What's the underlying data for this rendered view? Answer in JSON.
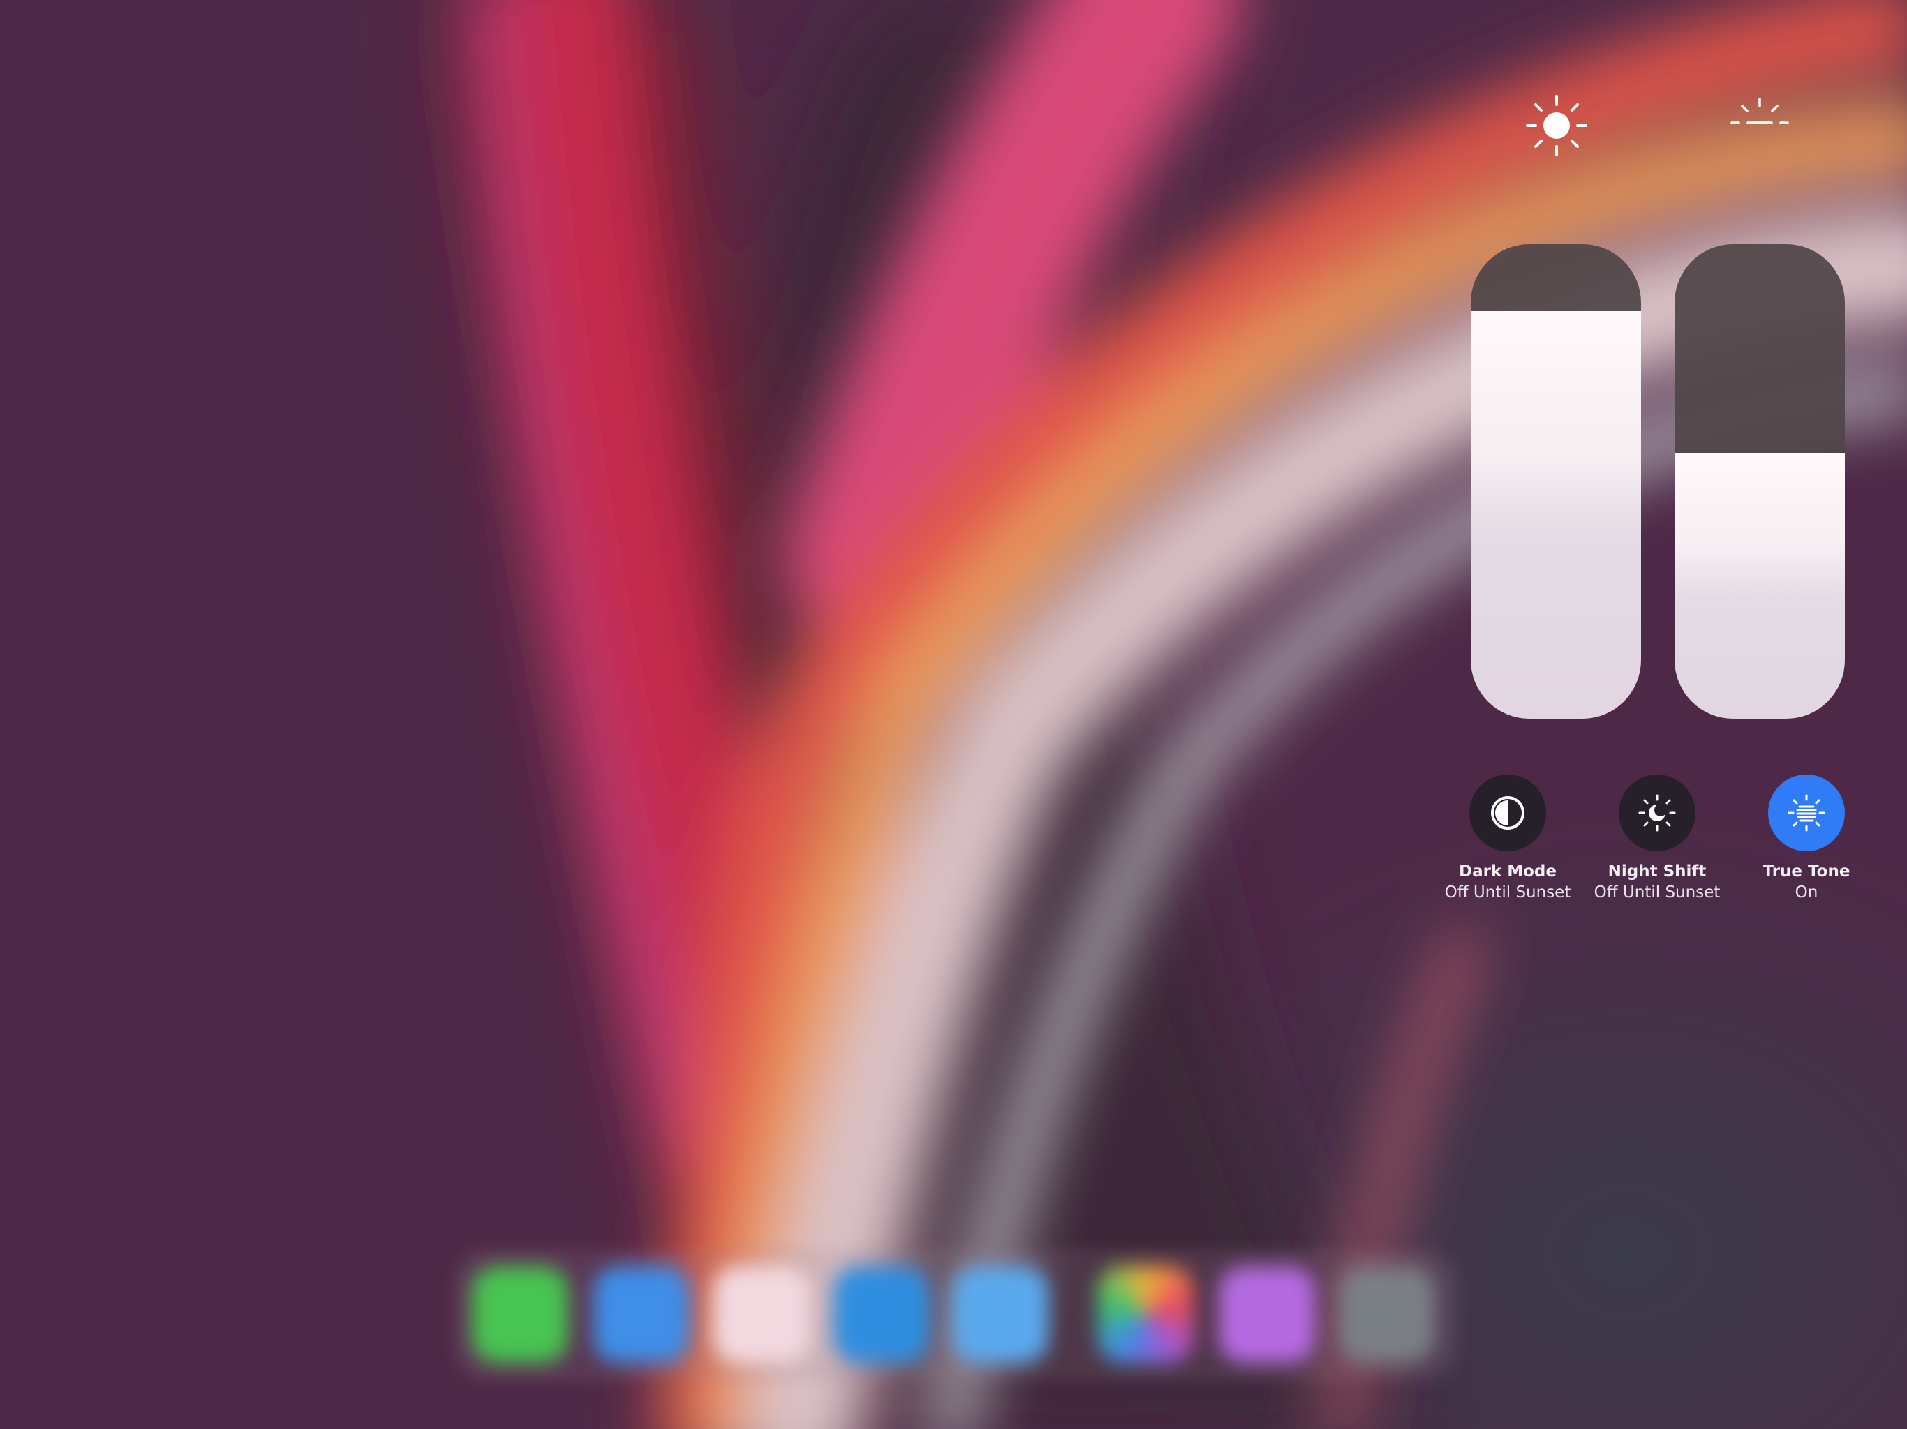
{
  "control_center": {
    "brightness": {
      "icon": "sun-icon",
      "level": 0.86
    },
    "true_tone_slider": {
      "icon": "sunrise-icon",
      "level": 0.56
    },
    "toggles": [
      {
        "icon": "dark-mode-icon",
        "title": "Dark Mode",
        "subtitle": "Off Until Sunset",
        "state": "off",
        "color": "#26202a"
      },
      {
        "icon": "night-shift-icon",
        "title": "Night Shift",
        "subtitle": "Off Until Sunset",
        "state": "off",
        "color": "#26202a"
      },
      {
        "icon": "true-tone-icon",
        "title": "True Tone",
        "subtitle": "On",
        "state": "on",
        "color": "#2f7cf6"
      }
    ]
  },
  "dock": {
    "apps": [
      {
        "icon": "messages-icon",
        "color": "#47c451"
      },
      {
        "icon": "safari-icon",
        "color": "#3f8ee8"
      },
      {
        "icon": "music-icon",
        "color": "#f2d9e0"
      },
      {
        "icon": "mail-icon",
        "color": "#2f8ee0"
      },
      {
        "icon": "files-icon",
        "color": "#5aa9ee"
      },
      {
        "icon": "photos-icon",
        "color": "#c8a0a8"
      },
      {
        "icon": "podcasts-icon",
        "color": "#b56ae0"
      },
      {
        "icon": "settings-icon",
        "color": "#7b7f86"
      }
    ]
  }
}
